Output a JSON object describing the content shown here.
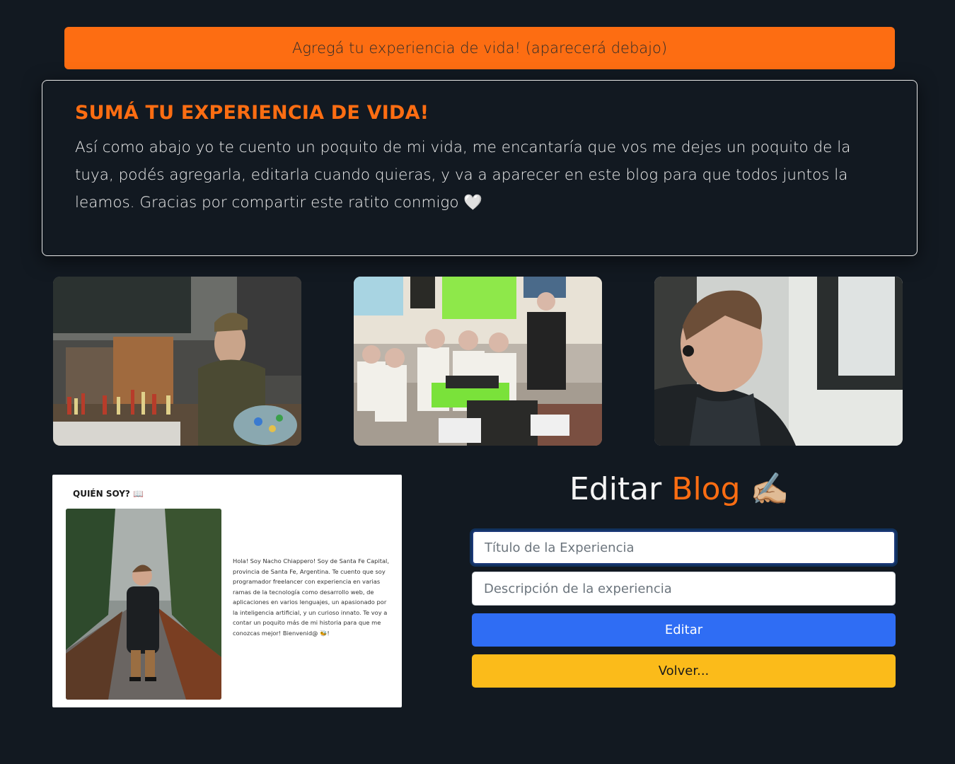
{
  "top_button": {
    "label": "Agregá tu experiencia de vida! (aparecerá debajo)"
  },
  "info_card": {
    "title": "SUMÁ TU EXPERIENCIA DE VIDA!",
    "text": "Así como abajo yo te cuento un poquito de mi vida, me encantaría que vos me dejes un poquito de la tuya, podés agregarla, editarla cuando quieras, y va a aparecer en este blog para que todos juntos la leamos. Gracias por compartir este ratito conmigo 🤍"
  },
  "gallery": {
    "photos": [
      {
        "name": "painter-photo",
        "alt": "painter-photo"
      },
      {
        "name": "group-photo",
        "alt": "group-photo"
      },
      {
        "name": "portrait-photo",
        "alt": "portrait-photo"
      }
    ]
  },
  "about_card": {
    "title": "QUIÉN SOY? 📖",
    "text": "Hola! Soy Nacho Chiappero! Soy de Santa Fe Capital, provincia de Santa Fe, Argentina. Te cuento que soy programador freelancer con experiencia en varias ramas de la tecnología como desarrollo web, de aplicaciones en varios lenguajes, un apasionado por la inteligencia artificial, y un curioso innato. Te voy a contar un poquito más de mi historia para que me conozcas mejor! Bienvenid@ 🐝!"
  },
  "edit_form": {
    "heading_part1": "Editar",
    "heading_part2": "Blog",
    "heading_emoji": "✍🏼",
    "title_placeholder": "Título de la Experiencia",
    "description_placeholder": "Descripción de la experiencia",
    "edit_label": "Editar",
    "back_label": "Volver..."
  },
  "colors": {
    "background": "#121921",
    "accent_orange": "#fd6d12",
    "edit_blue": "#2f6df4",
    "back_yellow": "#fbbb1a"
  }
}
